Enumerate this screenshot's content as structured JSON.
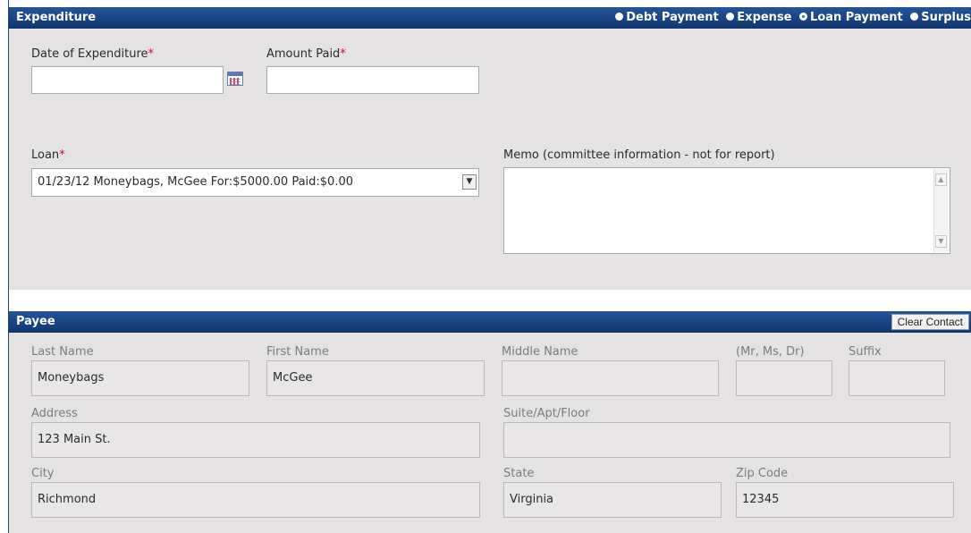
{
  "expenditure": {
    "title": "Expenditure",
    "types": [
      {
        "label": "Debt Payment",
        "selected": false
      },
      {
        "label": "Expense",
        "selected": false
      },
      {
        "label": "Loan Payment",
        "selected": true
      },
      {
        "label": "Surplus",
        "selected": false
      }
    ],
    "date_label": "Date of Expenditure",
    "date_value": "",
    "amount_label": "Amount Paid",
    "amount_value": "",
    "required_mark": "*",
    "loan_label": "Loan",
    "loan_selected": "01/23/12 Moneybags, McGee For:$5000.00 Paid:$0.00",
    "memo_label": "Memo (committee information - not for report)",
    "memo_value": ""
  },
  "payee": {
    "title": "Payee",
    "clear_button": "Clear Contact",
    "last_name_label": "Last Name",
    "last_name": "Moneybags",
    "first_name_label": "First Name",
    "first_name": "McGee",
    "middle_name_label": "Middle Name",
    "middle_name": "",
    "prefix_label": "(Mr, Ms, Dr)",
    "prefix": "",
    "suffix_label": "Suffix",
    "suffix": "",
    "address_label": "Address",
    "address": "123 Main St.",
    "suite_label": "Suite/Apt/Floor",
    "suite": "",
    "city_label": "City",
    "city": "Richmond",
    "state_label": "State",
    "state": "Virginia",
    "zip_label": "Zip Code",
    "zip": "12345"
  },
  "colors": {
    "header_blue": "#1a4585",
    "section_gray": "#e5e2e4",
    "required_red": "#c8102e",
    "selected_radio_green": "#2a8a3a"
  }
}
